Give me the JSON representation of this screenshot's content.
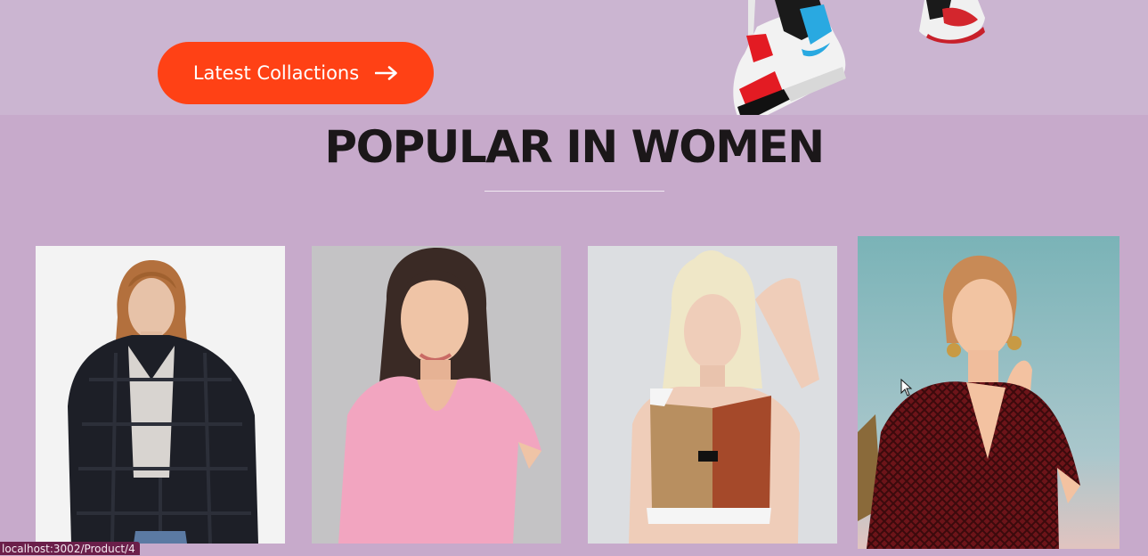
{
  "hero": {
    "cta_label": "Latest Collactions",
    "cta_icon": "arrow-right-icon",
    "images": [
      "sneaker-hanging-left",
      "sneaker-hanging-right"
    ]
  },
  "popular": {
    "title": "POPULAR IN WOMEN",
    "products": [
      {
        "image": "woman-black-fur-puffer-jacket"
      },
      {
        "image": "woman-pink-tshirt"
      },
      {
        "image": "woman-colorblock-sports-top"
      },
      {
        "image": "woman-red-patterned-blouse"
      }
    ]
  },
  "status_bar": {
    "url": "localhost:3002/Product/4"
  },
  "colors": {
    "accent": "#ff4115",
    "hero_bg": "#cbb5d1",
    "section_bg": "#c7aacb",
    "title_text": "#1b1719"
  }
}
